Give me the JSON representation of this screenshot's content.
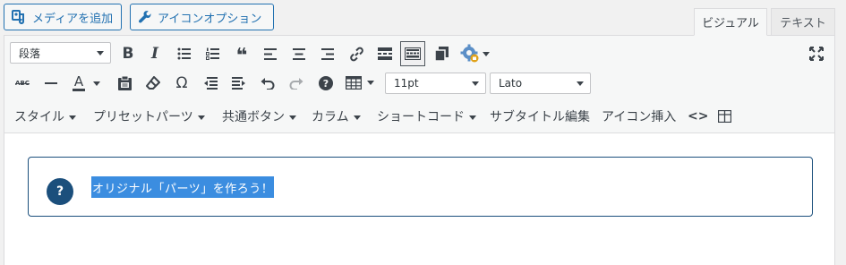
{
  "top_buttons": {
    "add_media": "メディアを追加",
    "icon_options": "アイコンオプション"
  },
  "tabs": {
    "visual": "ビジュアル",
    "text": "テキスト"
  },
  "toolbar": {
    "format_select": "段落",
    "font_size": "11pt",
    "font_family": "Lato",
    "menus": {
      "style": "スタイル",
      "preset_parts": "プリセットパーツ",
      "common_button": "共通ボタン",
      "column": "カラム",
      "shortcode": "ショートコード",
      "subtitle_edit": "サブタイトル編集",
      "icon_insert": "アイコン挿入"
    },
    "glyphs": {
      "bold": "B",
      "italic": "I",
      "quote": "❝",
      "strike": "ABC",
      "font_color": "A",
      "omega": "Ω",
      "help": "?",
      "code": "<>"
    }
  },
  "content": {
    "qa_icon": "?",
    "qa_text": "オリジナル「パーツ」を作ろう！"
  },
  "colors": {
    "accent": "#2271b1",
    "box_border": "#1b4f7c",
    "selection": "#3b8de0"
  }
}
